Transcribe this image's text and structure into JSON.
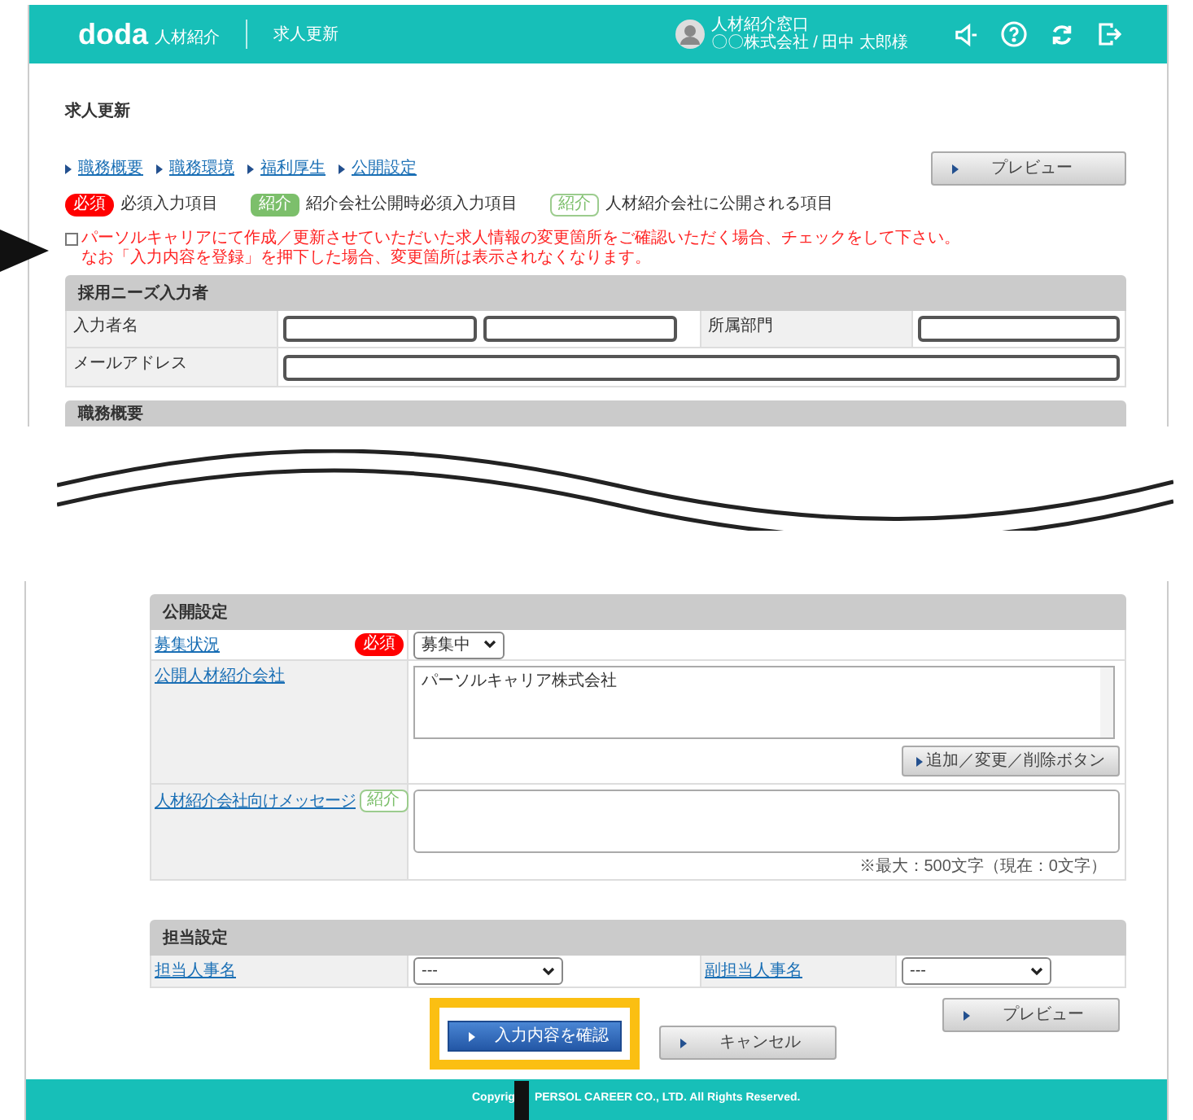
{
  "header": {
    "logo": "doda",
    "logo_sub": "人材紹介",
    "page": "求人更新",
    "user_line1": "人材紹介窓口",
    "user_line2": "〇〇株式会社 / 田中 太郎様"
  },
  "title": "求人更新",
  "anchors": [
    "職務概要",
    "職務環境",
    "福利厚生",
    "公開設定"
  ],
  "preview_button": "プレビュー",
  "legend": [
    {
      "kind": "required",
      "badge": "必須",
      "label": "必須入力項目"
    },
    {
      "kind": "agency_required",
      "badge": "紹介",
      "label": "紹介会社公開時必須入力項目"
    },
    {
      "kind": "agency",
      "badge": "紹介",
      "label": "人材紹介会社に公開される項目"
    }
  ],
  "notice": {
    "checked": false,
    "line1": "パーソルキャリアにて作成／更新させていただいた求人情報の変更箇所をご確認いただく場合、チェックをして下さい。",
    "line2": "なお「入力内容を登録」を押下した場合、変更箇所は表示されなくなります。"
  },
  "entrant_section": {
    "title": "採用ニーズ入力者",
    "name_label": "入力者名",
    "dept_label": "所属部門",
    "email_label": "メールアドレス"
  },
  "cut_section": {
    "title": "職務概要"
  },
  "publish_section": {
    "title": "公開設定",
    "status": {
      "label": "募集状況",
      "badge": "必須",
      "value": "募集中"
    },
    "agencies": {
      "label": "公開人材紹介会社",
      "value": "パーソルキャリア株式会社",
      "button": "追加／変更／削除ボタン"
    },
    "message": {
      "label": "人材紹介会社向けメッセージ",
      "badge": "紹介",
      "counter": "※最大：500文字（現在：0文字）"
    }
  },
  "staff_section": {
    "title": "担当設定",
    "main_label": "担当人事名",
    "main_value": "---",
    "sub_label": "副担当人事名",
    "sub_value": "---"
  },
  "bottom_preview_button": "プレビュー",
  "confirm_button": "入力内容を確認",
  "cancel_button": "キャンセル",
  "footer": {
    "left": "Copyrig",
    "right": "PERSOL CAREER CO., LTD. All Rights Reserved."
  }
}
